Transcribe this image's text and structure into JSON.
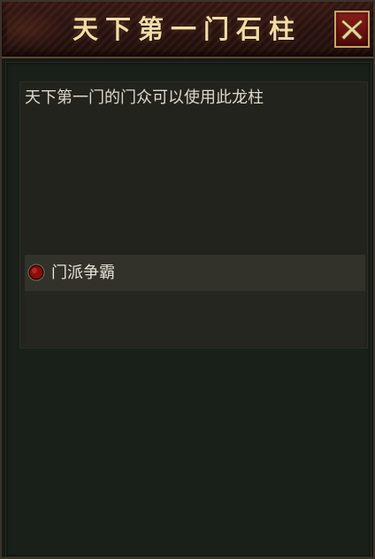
{
  "dialog": {
    "title": "天下第一门石柱",
    "close_icon": "close-x-icon"
  },
  "content": {
    "description": "天下第一门的门众可以使用此龙柱",
    "options": [
      {
        "label": "门派争霸",
        "icon": "red-orb-bullet-icon"
      }
    ]
  },
  "colors": {
    "title": "#f3dba6",
    "close_button": "#7a1614",
    "text": "#ddd8cc",
    "option_bg": "#32322b"
  }
}
